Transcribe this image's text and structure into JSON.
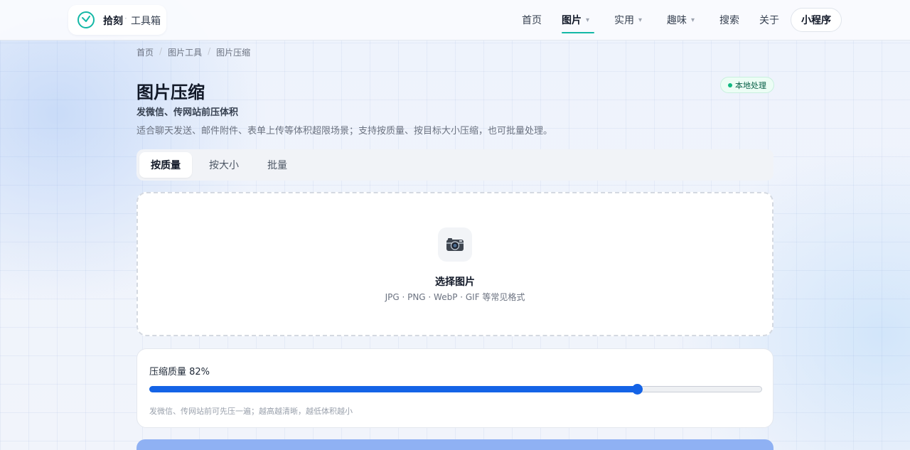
{
  "header": {
    "brand_name": "拾刻",
    "brand_separator": "·",
    "brand_sub": "工具箱",
    "nav": [
      {
        "label": "首页",
        "has_menu": false
      },
      {
        "label": "图片",
        "has_menu": true,
        "active": true
      },
      {
        "label": "实用",
        "has_menu": true
      },
      {
        "label": "趣味",
        "has_menu": true
      },
      {
        "label": "搜索",
        "has_menu": false
      },
      {
        "label": "关于",
        "has_menu": false
      }
    ],
    "mini_program_label": "小程序",
    "chevron": "⌄"
  },
  "breadcrumb": {
    "items": [
      "首页",
      "图片工具",
      "图片压缩"
    ],
    "separator": "/"
  },
  "page": {
    "title": "图片压缩",
    "subtitle": "发微信、传网站前压体积",
    "description": "适合聊天发送、邮件附件、表单上传等体积超限场景；支持按质量、按目标大小压缩，也可批量处理。",
    "badge": "本地处理"
  },
  "tabs": [
    {
      "label": "按质量",
      "active": true
    },
    {
      "label": "按大小",
      "active": false
    },
    {
      "label": "批量",
      "active": false
    }
  ],
  "upload": {
    "icon": "camera-icon",
    "icon_glyph": "📷",
    "title": "选择图片",
    "hint": "JPG · PNG · WebP · GIF 等常见格式"
  },
  "quality": {
    "label": "压缩质量 82%",
    "value": 82,
    "hint": "发微信、传网站前可先压一遍；越高越清晰，越低体积越小"
  },
  "colors": {
    "accent_teal": "#14b8a6",
    "slider_blue": "#1463e6",
    "badge_green": "#10b981",
    "primary_button_disabled": "#8fb1f3"
  }
}
